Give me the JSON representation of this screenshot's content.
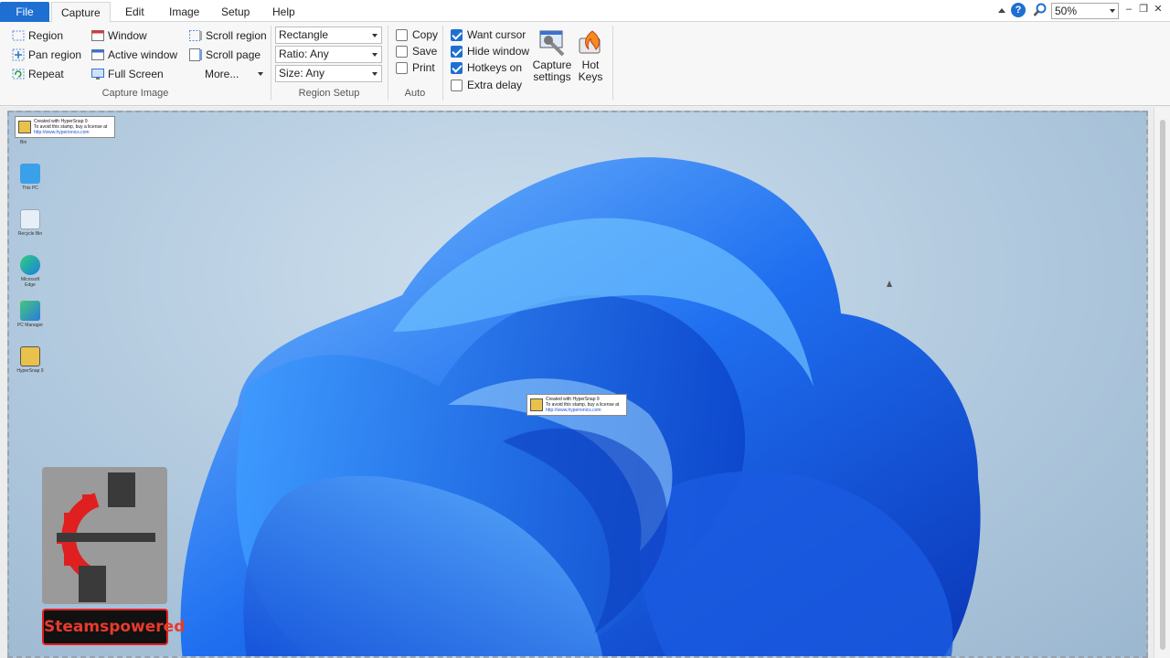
{
  "menubar": {
    "tabs": [
      "File",
      "Capture",
      "Edit",
      "Image",
      "Setup",
      "Help"
    ],
    "zoom": "50%"
  },
  "ribbon": {
    "capture_image": {
      "label": "Capture Image",
      "col1": [
        "Region",
        "Pan region",
        "Repeat"
      ],
      "col2": [
        "Window",
        "Active window",
        "Full Screen"
      ],
      "col3": [
        "Scroll region",
        "Scroll page",
        "More..."
      ]
    },
    "region_setup": {
      "label": "Region Setup",
      "shape": "Rectangle",
      "ratio": "Ratio: Any",
      "size": "Size: Any"
    },
    "auto": {
      "label": "Auto",
      "items": [
        {
          "label": "Copy",
          "checked": false
        },
        {
          "label": "Save",
          "checked": false
        },
        {
          "label": "Print",
          "checked": false
        }
      ]
    },
    "options": {
      "items": [
        {
          "label": "Want cursor",
          "checked": true
        },
        {
          "label": "Hide window",
          "checked": true
        },
        {
          "label": "Hotkeys on",
          "checked": true
        },
        {
          "label": "Extra delay",
          "checked": false
        }
      ],
      "capture_settings": [
        "Capture",
        "settings"
      ],
      "hot_keys": [
        "Hot",
        "Keys"
      ]
    }
  },
  "canvas": {
    "stamp": {
      "line1": "Created with HyperSnap 9",
      "line2": "To avoid this stamp, buy a license at",
      "line3": "http://www.hyperionics.com"
    },
    "desktop_icons": [
      "Bin",
      "This PC",
      "Recycle Bin",
      "Microsoft Edge",
      "PC Manager",
      "HyperSnap 9"
    ]
  },
  "watermark": {
    "label": "Steamspowered"
  },
  "colors": {
    "accent": "#1e6fd2",
    "watermark_red": "#e83a2c"
  }
}
